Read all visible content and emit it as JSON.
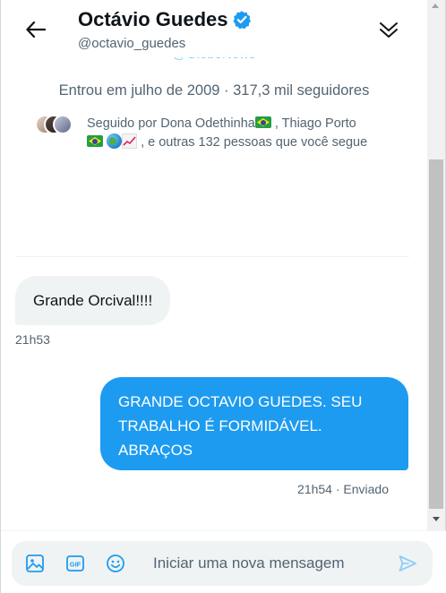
{
  "header": {
    "name": "Octávio Guedes",
    "handle": "@octavio_guedes"
  },
  "profile": {
    "partial_link": "@GloboNews",
    "joined": "Entrou em julho de 2009 · 317,3 mil seguidores",
    "followed_by_prefix": "Seguido por Dona Odethinha",
    "followed_by_sep": " , Thiago Porto",
    "followed_by_suffix": ", e outras 132 pessoas que você segue"
  },
  "messages": [
    {
      "text": "Grande Orcival!!!!",
      "time": "21h53"
    },
    {
      "text": "GRANDE OCTAVIO GUEDES. SEU TRABALHO É FORMIDÁVEL. ABRAÇOS",
      "time": "21h54 · Enviado"
    }
  ],
  "composer": {
    "placeholder": "Iniciar uma nova mensagem"
  },
  "colors": {
    "accent": "#1d9bf0",
    "secondary_text": "#536471",
    "incoming_bubble": "#eff3f4"
  },
  "icons": [
    "back-arrow-icon",
    "verified-badge-icon",
    "collapse-chevrons-icon",
    "image-icon",
    "gif-icon",
    "emoji-icon",
    "send-icon"
  ]
}
